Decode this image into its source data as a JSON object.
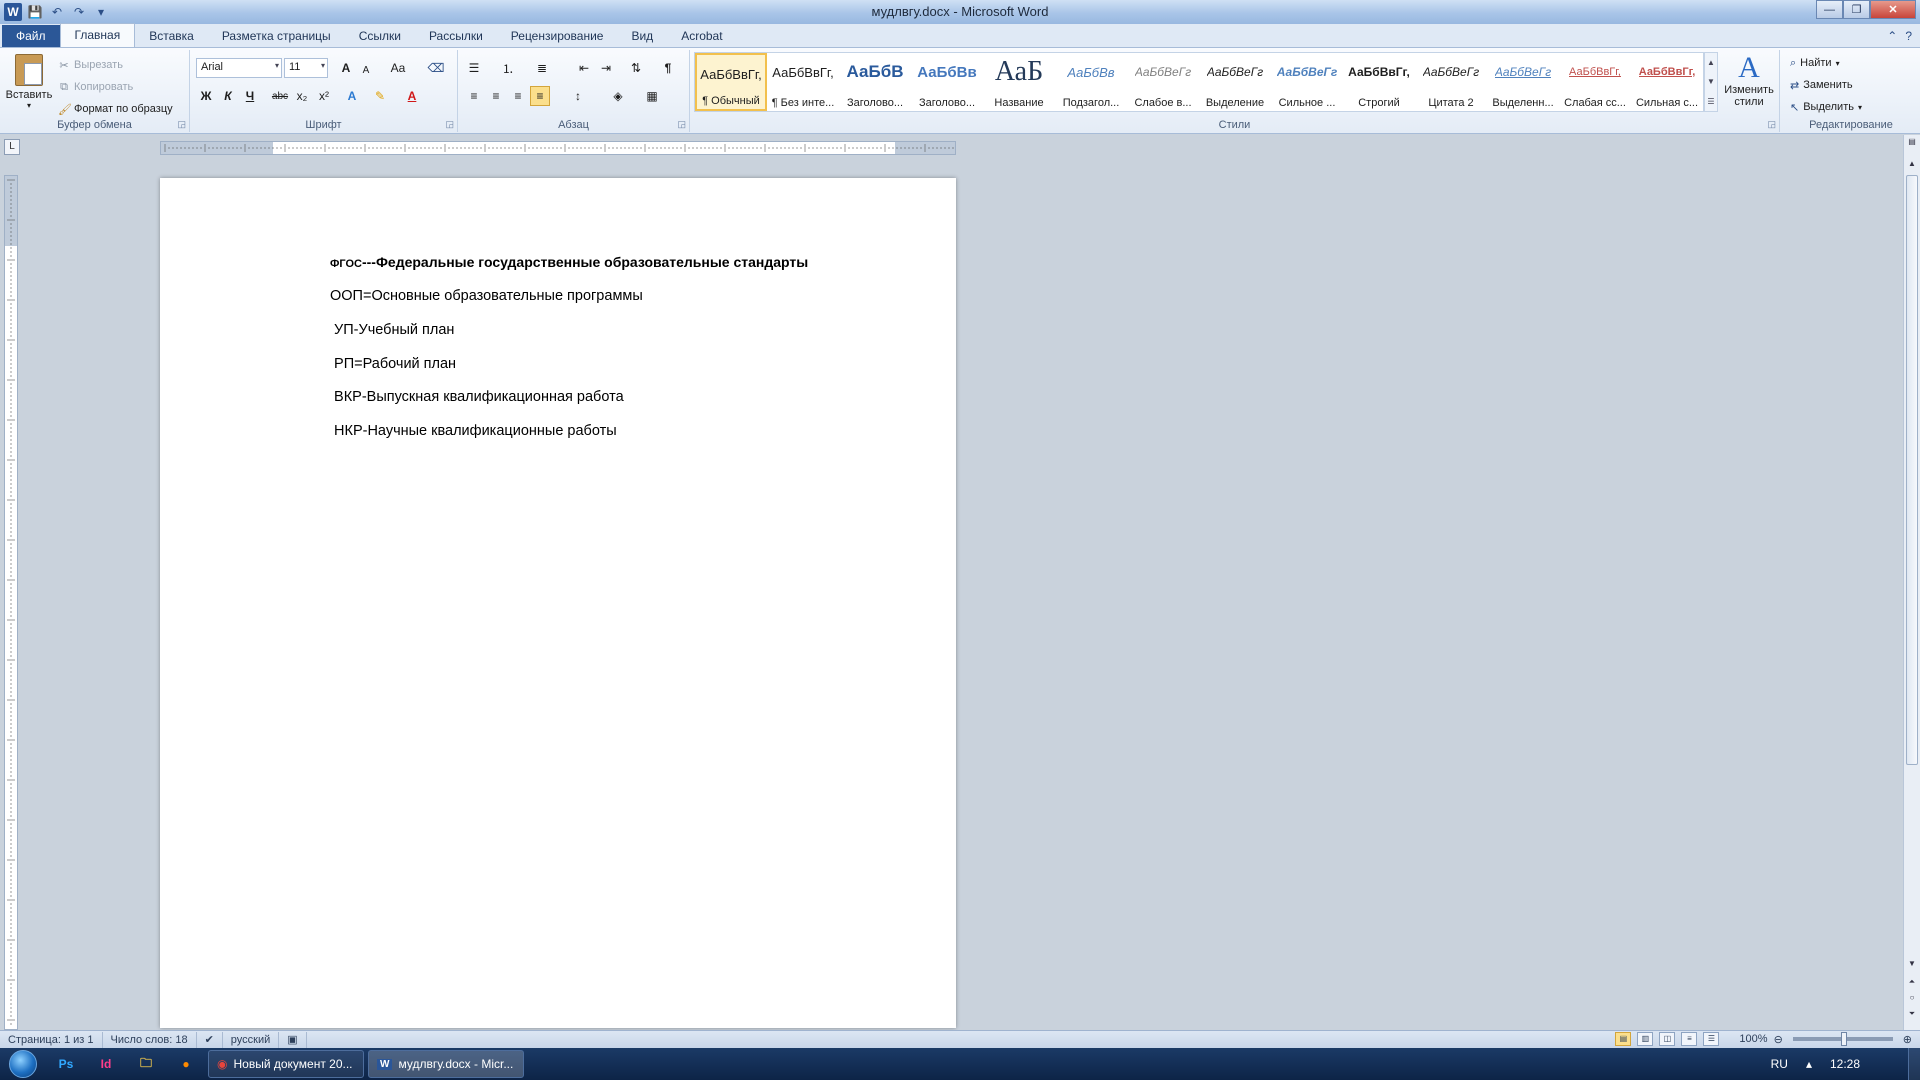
{
  "window": {
    "title": "мудлвгу.docx - Microsoft Word"
  },
  "tabs": [
    "Файл",
    "Главная",
    "Вставка",
    "Разметка страницы",
    "Ссылки",
    "Рассылки",
    "Рецензирование",
    "Вид",
    "Acrobat"
  ],
  "ribbon": {
    "clipboard": {
      "paste": "Вставить",
      "cut": "Вырезать",
      "copy": "Копировать",
      "format_painter": "Формат по образцу",
      "label": "Буфер обмена"
    },
    "font": {
      "name": "Arial",
      "size": "11",
      "label": "Шрифт",
      "bold": "Ж",
      "italic": "К",
      "underline": "Ч",
      "strike": "abc",
      "sub": "x₂",
      "sup": "x²",
      "grow": "A",
      "shrink": "A",
      "case": "Aa"
    },
    "paragraph": {
      "label": "Абзац",
      "pilcrow": "¶"
    },
    "styles": {
      "label": "Стили",
      "items": [
        {
          "sample": "АаБбВвГг,",
          "name": "¶ Обычный"
        },
        {
          "sample": "АаБбВвГг,",
          "name": "¶ Без инте..."
        },
        {
          "sample": "АаБбВ",
          "name": "Заголово..."
        },
        {
          "sample": "АаБбВв",
          "name": "Заголово..."
        },
        {
          "sample": "АаБ",
          "name": "Название"
        },
        {
          "sample": "АаБбВв",
          "name": "Подзагол..."
        },
        {
          "sample": "АаБбВеГг",
          "name": "Слабое в..."
        },
        {
          "sample": "АаБбВеГг",
          "name": "Выделение"
        },
        {
          "sample": "АаБбВеГг",
          "name": "Сильное ..."
        },
        {
          "sample": "АаБбВвГг,",
          "name": "Строгий"
        },
        {
          "sample": "АаБбВеГг",
          "name": "Цитата 2"
        },
        {
          "sample": "АаБбВеГг",
          "name": "Выделенн..."
        },
        {
          "sample": "АаБбВвГг,",
          "name": "Слабая сс..."
        },
        {
          "sample": "АаБбВвГг,",
          "name": "Сильная с..."
        }
      ],
      "change_line1": "Изменить",
      "change_line2": "стили"
    },
    "editing": {
      "label": "Редактирование",
      "find": "Найти",
      "replace": "Заменить",
      "select": "Выделить"
    }
  },
  "document": {
    "line1_prefix": "ФГОС",
    "line1_rest": "---Федеральные государственные образовательные стандарты",
    "lines": [
      "ООП=Основные образовательные программы",
      " УП-Учебный план",
      " РП=Рабочий план",
      " ВКР-Выпускная квалификационная работа",
      " НКР-Научные квалификационные работы"
    ]
  },
  "statusbar": {
    "page": "Страница: 1 из 1",
    "words": "Число слов: 18",
    "language": "русский",
    "zoom": "100%"
  },
  "taskbar": {
    "tasks": [
      "Новый документ 20...",
      "мудлвгу.docx - Micr..."
    ],
    "lang": "RU",
    "time": "12:28",
    "ps_label": "Ps",
    "id_label": "Id"
  },
  "colors": {
    "accent": "#2b5797",
    "selected_style": "#f2c04d"
  }
}
